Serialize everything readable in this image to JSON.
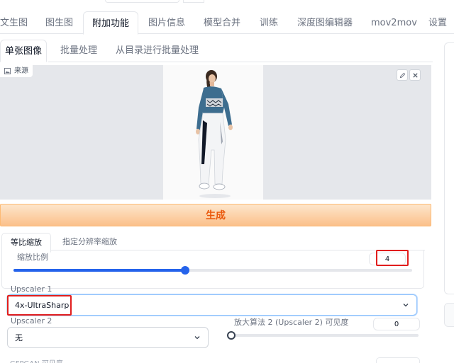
{
  "main_tabs": [
    "文生图",
    "图生图",
    "附加功能",
    "图片信息",
    "模型合并",
    "训练",
    "深度图编辑器",
    "mov2mov",
    "设置"
  ],
  "sub_tabs": [
    "单张图像",
    "批量处理",
    "从目录进行批量处理"
  ],
  "image": {
    "source_label": "来源",
    "edit_icon": "pencil-icon",
    "close_icon": "close-icon"
  },
  "generate_label": "生成",
  "scale_tabs": [
    "等比缩放",
    "指定分辨率缩放"
  ],
  "scale": {
    "label": "缩放比例",
    "value": "4",
    "slider_fraction": 0.43
  },
  "upscaler1": {
    "label": "Upscaler 1",
    "value": "4x-UltraSharp"
  },
  "upscaler2": {
    "label": "Upscaler 2",
    "value": "无"
  },
  "upscaler2_visibility": {
    "label": "放大算法 2 (Upscaler 2) 可见度",
    "value": "0",
    "slider_fraction": 0
  },
  "gfpgan_label": "GFPGAN 可见度",
  "colors": {
    "accent": "#2563eb",
    "generate_text": "#ea580c",
    "highlight": "#e11d1d"
  }
}
